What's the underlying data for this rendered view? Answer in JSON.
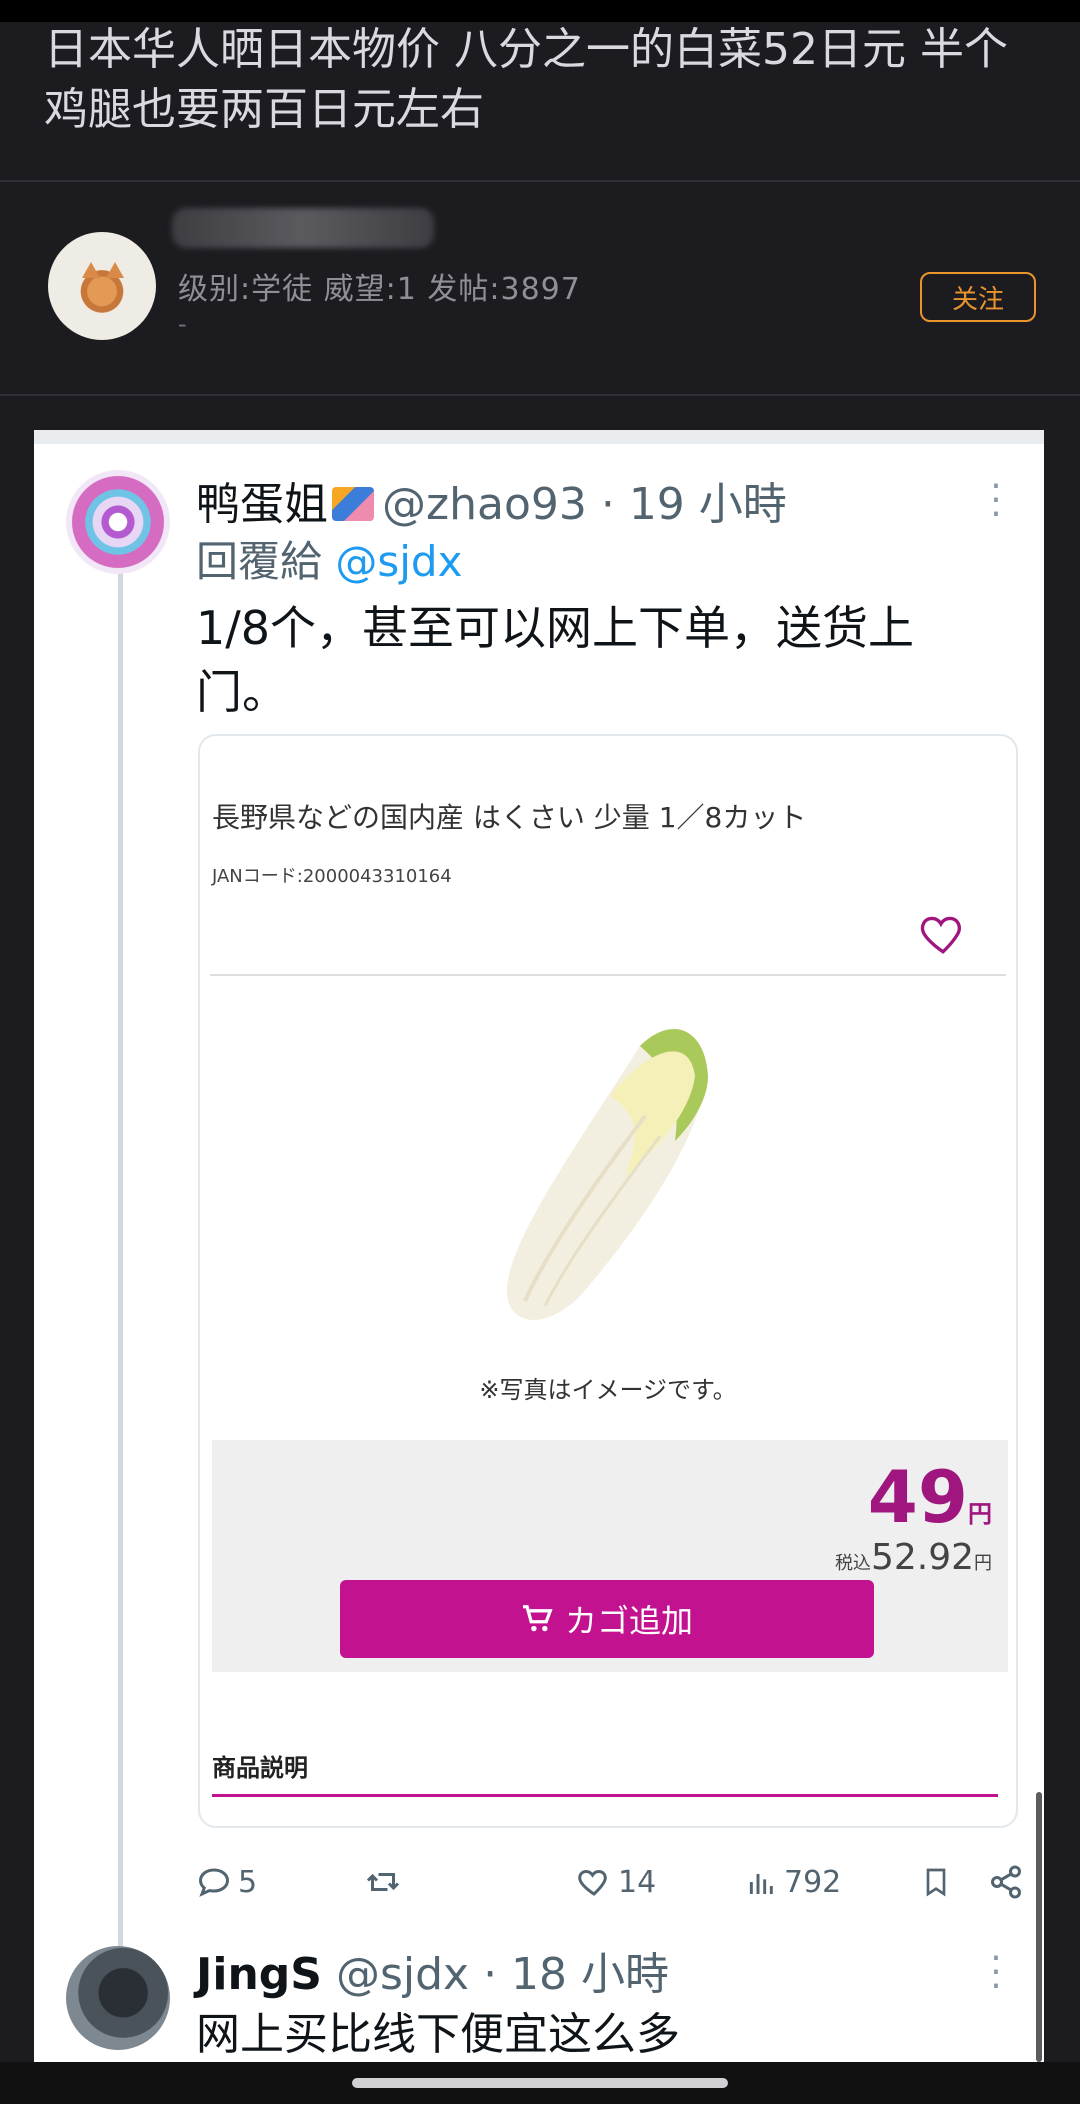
{
  "post": {
    "title": "日本华人晒日本物价 八分之一的白菜52日元 半个鸡腿也要两百日元左右"
  },
  "author": {
    "meta": "级别:学徒 威望:1 发帖:3897",
    "dash": "-",
    "follow_label": "关注"
  },
  "tweet1": {
    "name": "鸭蛋姐",
    "handle": "@zhao93 · 19 小時",
    "reply_prefix": "回覆給",
    "reply_to": "@sjdx",
    "text": "1/8个，甚至可以网上下单，送货上门。",
    "card": {
      "product_title": "長野県などの国内産 はくさい 少量 1／8カット",
      "jan": "JANコード:2000043310164",
      "photo_note": "※写真はイメージです。",
      "price": "49",
      "price_unit": "円",
      "tax_prefix": "税込",
      "tax_price": "52.92",
      "tax_unit": "円",
      "cart_label": "カゴ追加",
      "desc_label": "商品説明"
    },
    "actions": {
      "replies": "5",
      "likes": "14",
      "views": "792"
    }
  },
  "tweet2": {
    "name": "JingS",
    "handle": "@sjdx · 18 小時",
    "text": "网上买比线下便宜这么多"
  },
  "colors": {
    "accent_follow": "#e8962b",
    "cart_button": "#c2128f",
    "mention_blue": "#1d9bf0"
  },
  "icons": [
    "cat-avatar",
    "menu-dots-icon",
    "heart-icon",
    "cart-icon",
    "reply-icon",
    "retweet-icon",
    "like-icon",
    "views-icon",
    "bookmark-icon",
    "share-icon"
  ]
}
